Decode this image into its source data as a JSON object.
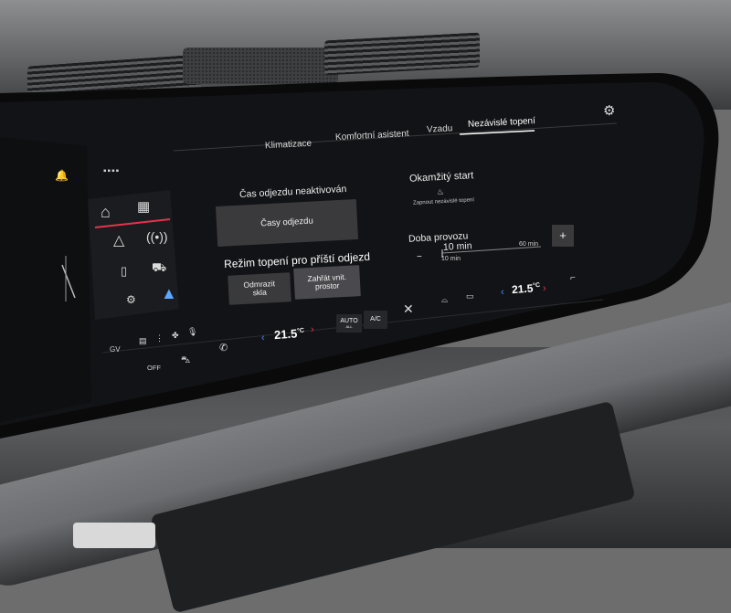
{
  "tabs": [
    {
      "label": "Klimatizace"
    },
    {
      "label": "Komfortní asistent"
    },
    {
      "label": "Vzadu"
    },
    {
      "label": "Nezávislé topení"
    }
  ],
  "departure": {
    "status_label": "Čas odjezdu neaktivován",
    "times_button": "Časy odjezdu",
    "mode_title": "Režim topení pro příští odjezd",
    "mode_option_1": "Odmrazit skla",
    "mode_option_2": "Zahřát vnit. prostor"
  },
  "instant_start": {
    "title": "Okamžitý start",
    "toggle_label": "Zapnout nezávislé topení"
  },
  "duration": {
    "title": "Doba provozu",
    "value": "10 min",
    "min_label": "10 min",
    "max_label": "60 min",
    "minus": "−",
    "plus": "+"
  },
  "climate_bar": {
    "driver_temp": "21.5",
    "passenger_temp": "21.5",
    "unit": "°C",
    "auto_label": "AUTO",
    "auto_sub": "ALL",
    "ac_label": "A/C",
    "off_label": "OFF",
    "gv_label": "GV"
  },
  "icons": {
    "settings": "gear-icon",
    "home": "home-icon",
    "apps": "grid-icon",
    "navigation": "navigation-arrow-icon",
    "radio": "radio-antenna-icon",
    "phone": "phone-icon",
    "car": "car-icon",
    "car_settings": "car-gear-icon",
    "assistant": "assistant-triangle-icon",
    "seat_heat": "seat-heating-icon",
    "steering_heat": "steering-heat-icon",
    "fan": "fan-icon",
    "windshield": "windshield-defrost-icon",
    "rear_defrost": "rear-defrost-icon",
    "voice": "microphone-icon",
    "notification": "bell-icon"
  },
  "colors": {
    "accent_red": "#e6324b",
    "accent_blue": "#4c8dff",
    "screen_bg": "#111214"
  }
}
